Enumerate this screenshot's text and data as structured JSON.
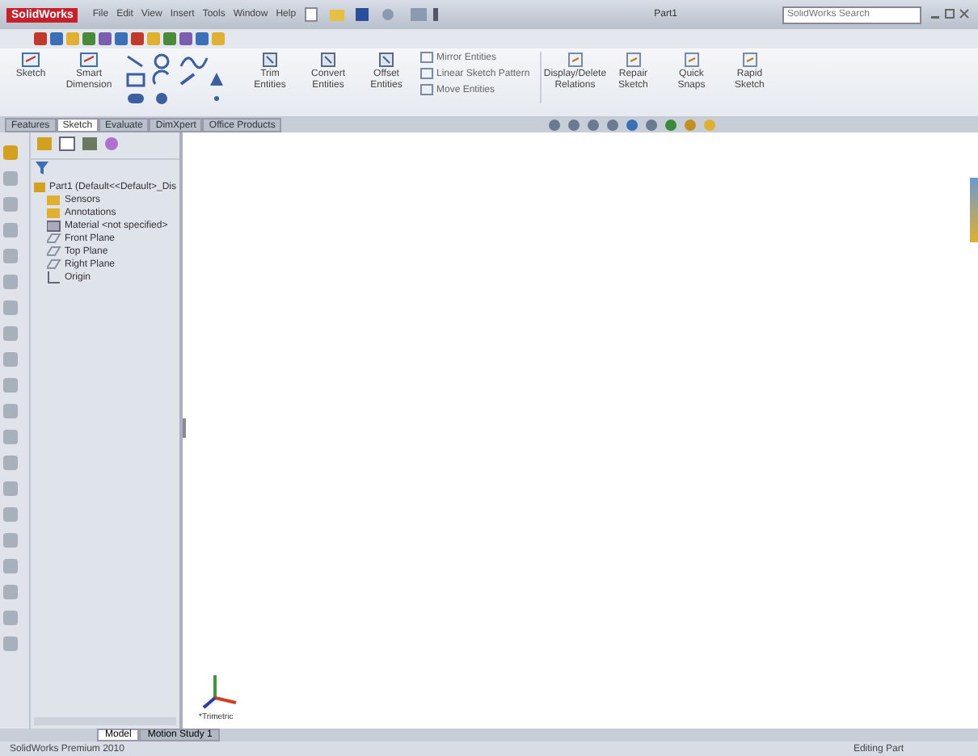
{
  "app": {
    "logo": "SolidWorks",
    "menu": [
      "File",
      "Edit",
      "View",
      "Insert",
      "Tools",
      "Window",
      "Help"
    ],
    "document_title": "Part1",
    "search": {
      "placeholder": "SolidWorks Search"
    }
  },
  "ribbon": {
    "commands_left": [
      "Sketch",
      "Smart Dimension"
    ],
    "commands_mid": [
      "Trim Entities",
      "Convert Entities",
      "Offset Entities"
    ],
    "small_commands": [
      "Mirror Entities",
      "Linear Sketch Pattern",
      "Move Entities"
    ],
    "commands_right": [
      "Display/Delete Relations",
      "Repair Sketch",
      "Quick Snaps",
      "Rapid Sketch"
    ]
  },
  "command_tabs": [
    {
      "label": "Features",
      "selected": false
    },
    {
      "label": "Sketch",
      "selected": true
    },
    {
      "label": "Evaluate",
      "selected": false
    },
    {
      "label": "DimXpert",
      "selected": false
    },
    {
      "label": "Office Products",
      "selected": false
    }
  ],
  "feature_tree": {
    "label": "Part1  (Default<<Default>_Dis",
    "children": [
      {
        "label": "Sensors",
        "kind": "folder"
      },
      {
        "label": "Annotations",
        "kind": "folder"
      },
      {
        "label": "Material <not specified>",
        "kind": "material"
      },
      {
        "label": "Front Plane",
        "kind": "plane"
      },
      {
        "label": "Top Plane",
        "kind": "plane"
      },
      {
        "label": "Right Plane",
        "kind": "plane"
      },
      {
        "label": "Origin",
        "kind": "origin"
      }
    ]
  },
  "view": {
    "orientation": "*Trimetric"
  },
  "bottom_tabs": [
    {
      "label": "Model",
      "selected": true
    },
    {
      "label": "Motion Study 1",
      "selected": false
    }
  ],
  "status_bar": {
    "product": "SolidWorks Premium 2010",
    "mode": "Editing Part"
  }
}
